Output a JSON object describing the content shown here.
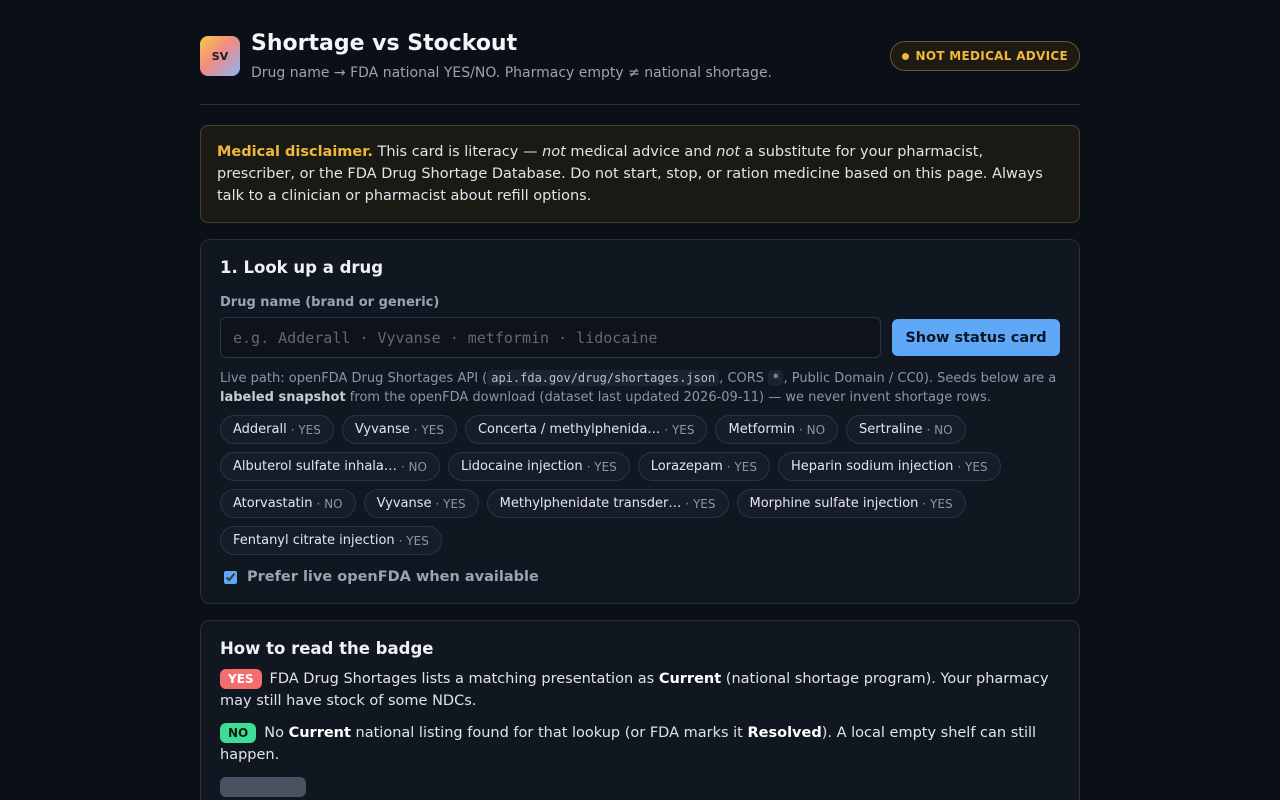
{
  "header": {
    "logo_text": "SV",
    "title": "Shortage vs Stockout",
    "subtitle": "Drug name → FDA national YES/NO. Pharmacy empty ≠ national shortage.",
    "warning_pill": "NOT MEDICAL ADVICE"
  },
  "disclaimer": {
    "lead": "Medical disclaimer.",
    "text_1": " This card is literacy — ",
    "em_1": "not",
    "text_2": " medical advice and ",
    "em_2": "not",
    "text_3": " a substitute for your pharmacist, prescriber, or the FDA Drug Shortage Database. Do not start, stop, or ration medicine based on this page. Always talk to a clinician or pharmacist about refill options."
  },
  "lookup": {
    "heading": "1. Look up a drug",
    "field_label": "Drug name (brand or generic)",
    "input_value": "",
    "input_placeholder": "e.g. Adderall · Vyvanse · metformin · lidocaine",
    "submit_label": "Show status card",
    "help_1": "Live path: openFDA Drug Shortages API (",
    "help_code_1": "api.fda.gov/drug/shortages.json",
    "help_2": ", CORS ",
    "help_code_2": "*",
    "help_3": ", Public Domain / CC0). Seeds below are a ",
    "help_bold": "labeled snapshot",
    "help_4": " from the openFDA download (dataset last updated 2026-09-11) — we never invent shortage rows.",
    "chips": [
      {
        "name": "Adderall",
        "status": "· YES"
      },
      {
        "name": "Vyvanse",
        "status": "· YES"
      },
      {
        "name": "Concerta / methylphenida…",
        "status": "· YES"
      },
      {
        "name": "Metformin",
        "status": "· NO"
      },
      {
        "name": "Sertraline",
        "status": "· NO"
      },
      {
        "name": "Albuterol sulfate inhala…",
        "status": "· NO"
      },
      {
        "name": "Lidocaine injection",
        "status": "· YES"
      },
      {
        "name": "Lorazepam",
        "status": "· YES"
      },
      {
        "name": "Heparin sodium injection",
        "status": "· YES"
      },
      {
        "name": "Atorvastatin",
        "status": "· NO"
      },
      {
        "name": "Vyvanse",
        "status": "· YES"
      },
      {
        "name": "Methylphenidate transder…",
        "status": "· YES"
      },
      {
        "name": "Morphine sulfate injection",
        "status": "· YES"
      },
      {
        "name": "Fentanyl citrate injection",
        "status": "· YES"
      }
    ],
    "prefer_live_label": "Prefer live openFDA when available",
    "prefer_live_checked": true
  },
  "badge_guide": {
    "heading": "How to read the badge",
    "yes": {
      "badge": "YES",
      "text_1": "FDA Drug Shortages lists a matching presentation as ",
      "bold_1": "Current",
      "text_2": " (national shortage program). Your pharmacy may still have stock of some NDCs."
    },
    "no": {
      "badge": "NO",
      "text_1": "No ",
      "bold_1": "Current",
      "text_2": " national listing found for that lookup (or FDA marks it ",
      "bold_2": "Resolved",
      "text_3": "). A local empty shelf can still happen."
    }
  },
  "colors": {
    "accent": "#5ea8f7",
    "warning": "#f2b73a",
    "yes": "#f46e6e",
    "no": "#3ddc97"
  }
}
